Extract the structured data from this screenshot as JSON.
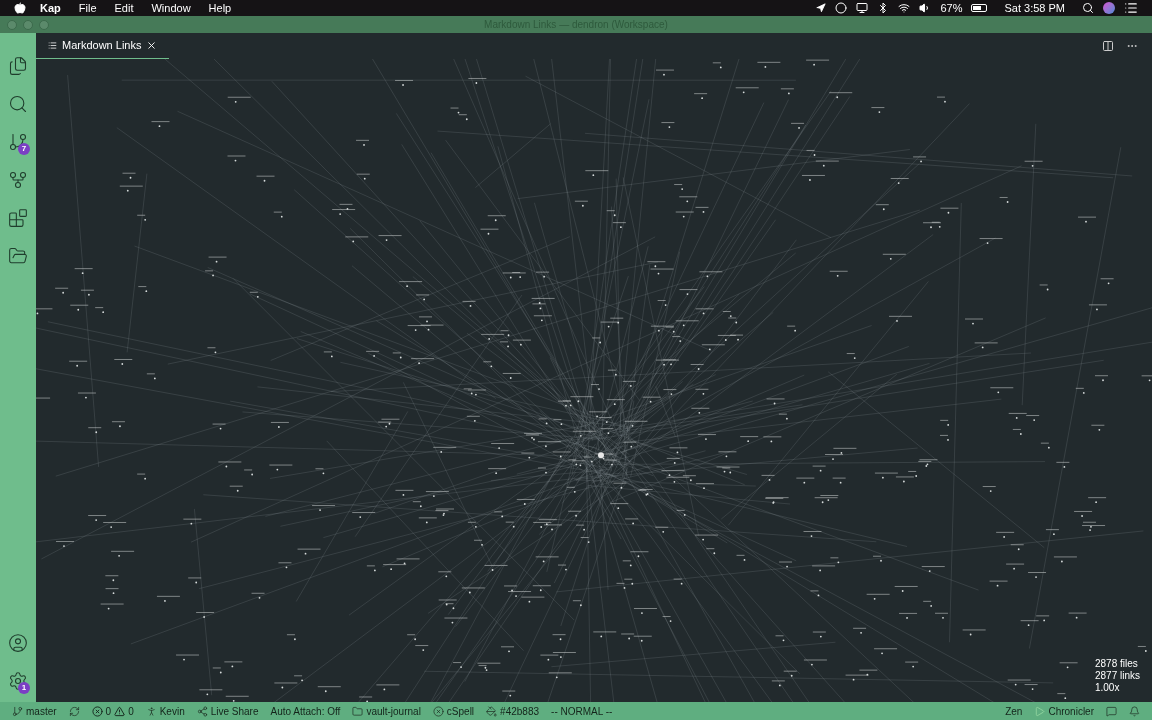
{
  "menu_bar": {
    "app": "Kap",
    "menus": [
      "File",
      "Edit",
      "Window",
      "Help"
    ],
    "battery": "67%",
    "clock": "Sat 3:58 PM"
  },
  "window": {
    "title": "Markdown Links — dendron (Workspace)"
  },
  "activity_bar": [
    {
      "kind": "files"
    },
    {
      "kind": "search"
    },
    {
      "kind": "source-control",
      "badge": "7"
    },
    {
      "kind": "git-graph"
    },
    {
      "kind": "extensions"
    },
    {
      "kind": "folder"
    }
  ],
  "activity_bar_bottom": [
    {
      "kind": "account"
    },
    {
      "kind": "settings",
      "badge": "1"
    }
  ],
  "tabs": [
    {
      "label": "Markdown Links",
      "selected": true
    }
  ],
  "graph": {
    "files": "2878 files",
    "links": "2877 links",
    "zoom": "1.00x"
  },
  "status_bar": {
    "left": [
      {
        "kind": "branch",
        "text": "master"
      },
      {
        "kind": "sync"
      },
      {
        "kind": "problems",
        "errors": "0",
        "warnings": "0"
      },
      {
        "kind": "person",
        "text": "Kevin"
      },
      {
        "kind": "share",
        "text": "Live Share"
      },
      {
        "kind": "plain",
        "text": "Auto Attach: Off"
      },
      {
        "kind": "folder",
        "text": "vault-journal"
      },
      {
        "kind": "error",
        "text": "cSpell"
      },
      {
        "kind": "paint",
        "text": "#42b883"
      },
      {
        "kind": "plain",
        "text": "-- NORMAL --"
      }
    ],
    "right": [
      {
        "kind": "plain",
        "text": "Zen"
      },
      {
        "kind": "play",
        "text": "Chronicler"
      },
      {
        "kind": "feedback"
      },
      {
        "kind": "bell"
      }
    ]
  }
}
